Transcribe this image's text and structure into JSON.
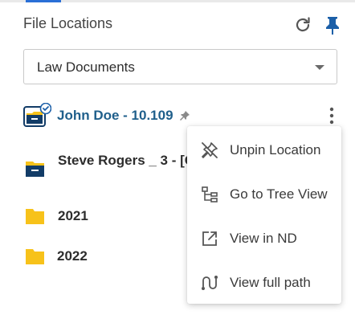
{
  "panel": {
    "title": "File Locations",
    "refresh_icon": "refresh-icon",
    "pin_icon": "pin-icon"
  },
  "location_select": {
    "selected": "Law Documents"
  },
  "locations": [
    {
      "label": "John Doe - 10.109",
      "icon": "shared-folder-icon",
      "pinned": true,
      "color": "#1f5f8b"
    },
    {
      "label": "Steve Rogers _ 3 - [C",
      "icon": "folder-icon",
      "color": "#2d2d2d"
    },
    {
      "label": "2021",
      "icon": "folder-icon"
    },
    {
      "label": "2022",
      "icon": "folder-icon"
    }
  ],
  "context_menu": {
    "items": [
      {
        "label": "Unpin Location",
        "icon": "unpin-icon"
      },
      {
        "label": "Go to Tree View",
        "icon": "tree-view-icon"
      },
      {
        "label": "View in ND",
        "icon": "open-external-icon"
      },
      {
        "label": "View full path",
        "icon": "path-icon"
      }
    ]
  },
  "colors": {
    "accent": "#2a6fd6",
    "pin": "#1b5fa8",
    "folder_yellow": "#f7c21a",
    "folder_navy": "#123c67"
  }
}
